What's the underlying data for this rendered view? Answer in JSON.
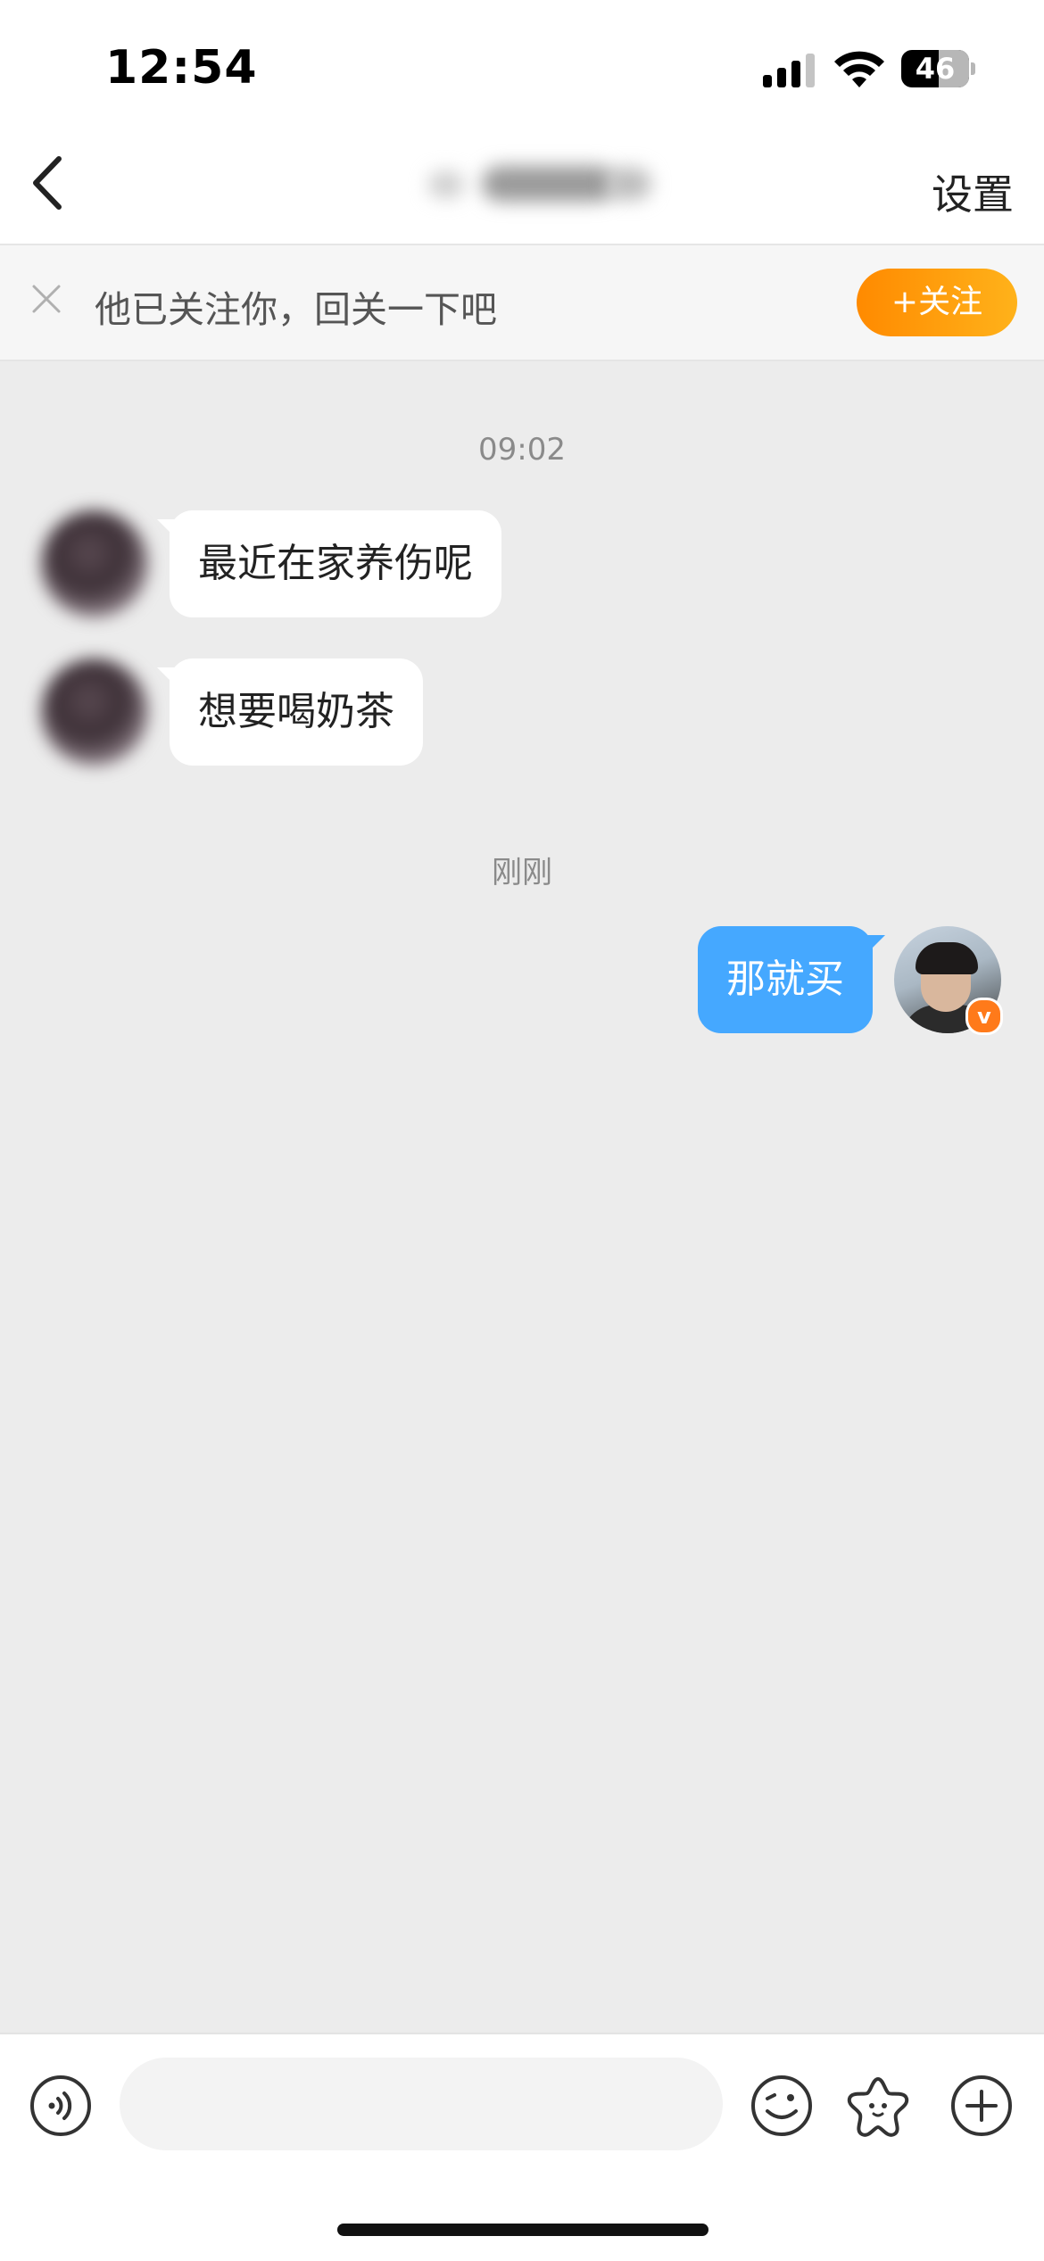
{
  "status_bar": {
    "time": "12:54",
    "battery": "46"
  },
  "header": {
    "settings_label": "设置"
  },
  "banner": {
    "text": "他已关注你，回关一下吧",
    "follow_label": "+关注"
  },
  "chat": {
    "time_first": "09:02",
    "messages_in": [
      {
        "text": "最近在家养伤呢"
      },
      {
        "text": "想要喝奶茶"
      }
    ],
    "time_second": "刚刚",
    "message_out": {
      "text": "那就买"
    },
    "my_badge": "v"
  },
  "input_bar": {
    "placeholder": ""
  },
  "colors": {
    "accent_orange": "#ff8a00",
    "bubble_blue": "#45a8ff",
    "chat_bg": "#ececec"
  }
}
